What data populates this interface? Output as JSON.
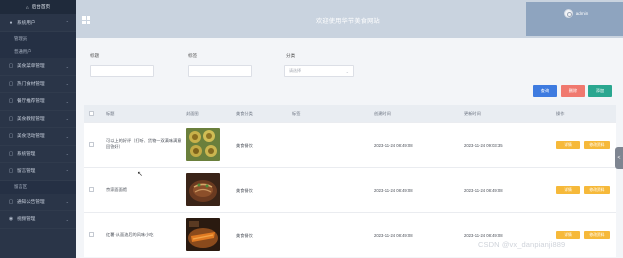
{
  "sidebar": {
    "brand": "后台首页",
    "items": [
      {
        "label": "系统用户",
        "icon": "user-icon",
        "expanded": true
      },
      {
        "label": "管理员",
        "sub": true
      },
      {
        "label": "普通用户",
        "sub": true
      },
      {
        "label": "美食菜单管理",
        "icon": "menu-icon"
      },
      {
        "label": "热门食材管理",
        "icon": "ingredient-icon"
      },
      {
        "label": "餐厅推荐管理",
        "icon": "restaurant-icon"
      },
      {
        "label": "美食教程管理",
        "icon": "book-icon"
      },
      {
        "label": "美食活动管理",
        "icon": "event-icon"
      },
      {
        "label": "系统管理",
        "icon": "system-icon"
      },
      {
        "label": "留言管理",
        "icon": "message-icon",
        "expanded": true
      },
      {
        "label": "留言区",
        "sub": true
      },
      {
        "label": "通知公告管理",
        "icon": "notice-icon"
      },
      {
        "label": "视频管理",
        "icon": "video-icon"
      }
    ]
  },
  "header": {
    "title": "欢迎使用华节美食网站",
    "user": "admin"
  },
  "search": {
    "label_title": "标题",
    "label_tag": "标签",
    "label_category": "分类",
    "category_placeholder": "请选择",
    "btn_search": "查询",
    "btn_delete": "删除",
    "btn_add": "添加"
  },
  "colors": {
    "sidebar": "#2a3548",
    "header": "#c9d3df",
    "search": "#3e7be0",
    "delete": "#f0796f",
    "add": "#2aa790",
    "action": "#f6b93a"
  },
  "table": {
    "columns": [
      "标题",
      "封面图",
      "美食分类",
      "标签",
      "创建时间",
      "更新时间",
      "操作"
    ],
    "rows": [
      {
        "title": "可以上的好评（打听、货物一双满味满意回答好）",
        "category": "美食餐饮",
        "tag": "",
        "created": "2023-11-24 08:49:08",
        "updated": "2023-11-24 09:03:35",
        "action_detail": "详情",
        "action_edit": "修改资料"
      },
      {
        "title": "京家面面馆",
        "category": "美食餐饮",
        "tag": "",
        "created": "2023-11-24 08:49:08",
        "updated": "2023-11-24 08:49:08",
        "action_detail": "详情",
        "action_edit": "修改资料"
      },
      {
        "title": "红薯·从面油后的风味小吃",
        "category": "美食餐饮",
        "tag": "",
        "created": "2023-11-24 08:49:08",
        "updated": "2023-11-24 08:49:08",
        "action_detail": "详情",
        "action_edit": "修改资料"
      }
    ]
  },
  "watermark": "CSDN @vx_danpianji889",
  "side_tab": "<"
}
